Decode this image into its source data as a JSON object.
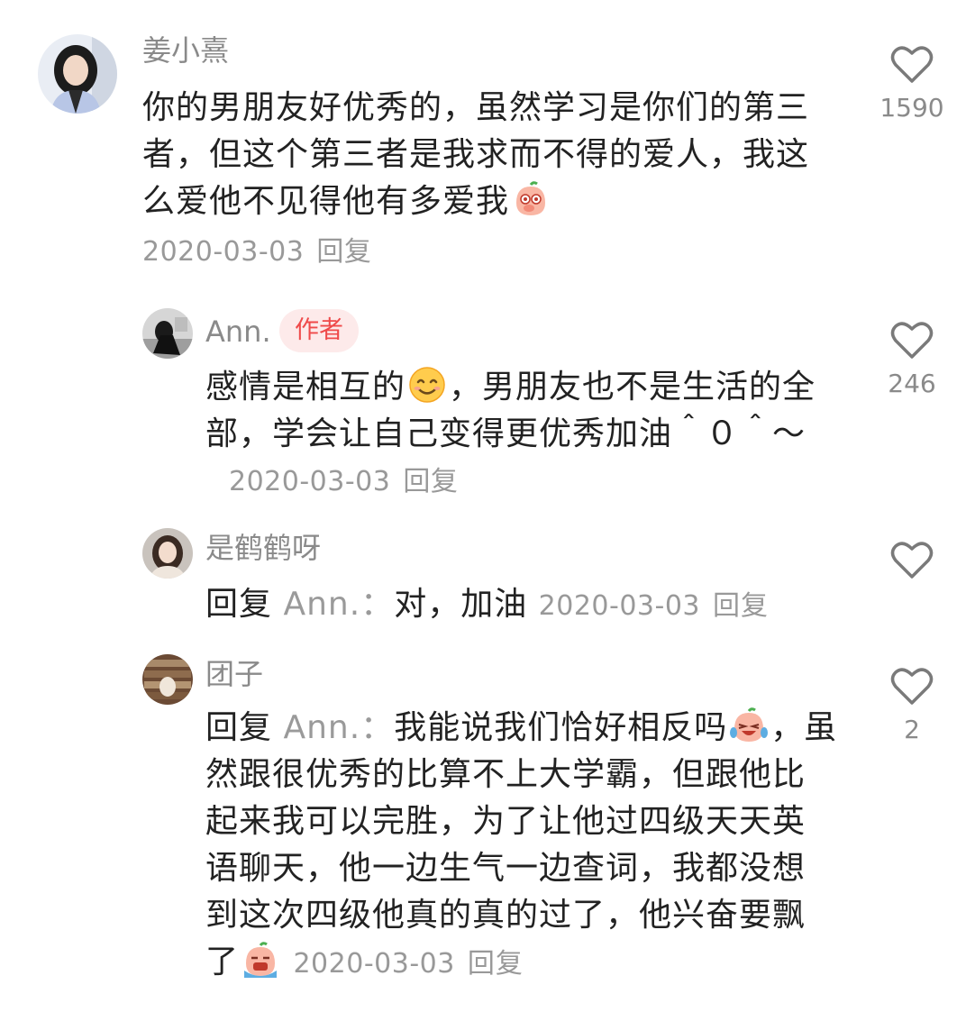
{
  "comments": [
    {
      "username": "姜小熹",
      "text": "你的男朋友好优秀的，虽然学习是你们的第三者，但这个第三者是我求而不得的爱人，我这么爱他不见得他有多爱我",
      "emoji": "shy-peach-emoji",
      "date": "2020-03-03",
      "reply_label": "回复",
      "likes": "1590"
    },
    {
      "username": "Ann.",
      "badge": "作者",
      "text_before": "感情是相互的",
      "emoji": "smile-emoji",
      "text_after": "，男朋友也不是生活的全部，学会让自己变得更优秀加油＾０＾～",
      "date": "2020-03-03",
      "reply_label": "回复",
      "likes": "246"
    },
    {
      "username": "是鹤鹤呀",
      "reply_prefix": "回复",
      "reply_target": "Ann.：",
      "text": "对，加油",
      "date": "2020-03-03",
      "reply_label": "回复"
    },
    {
      "username": "团子",
      "reply_prefix": "回复",
      "reply_target": "Ann.：",
      "text_before": "我能说我们恰好相反吗",
      "emoji": "laughing-tears-peach-emoji",
      "text_after": "，虽然跟很优秀的比算不上大学霸，但跟他比起来我可以完胜，为了让他过四级天天英语聊天，他一边生气一边查词，我都没想到这次四级他真的真的过了，他兴奋要飘了",
      "emoji_end": "crying-peach-emoji",
      "date": "2020-03-03",
      "reply_label": "回复",
      "likes": "2"
    }
  ],
  "colors": {
    "accent_tag_bg": "#fdeaea",
    "accent_tag_text": "#ef4a4a",
    "muted": "#999999",
    "text": "#222222"
  }
}
